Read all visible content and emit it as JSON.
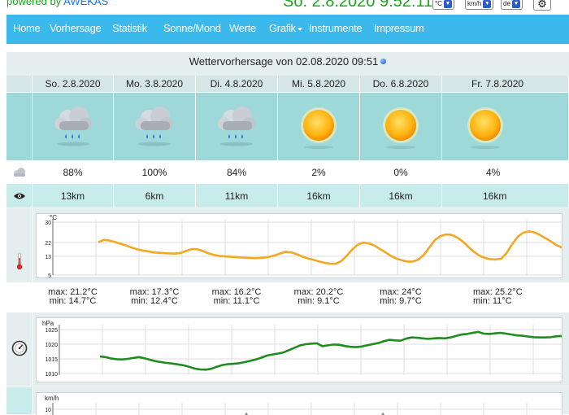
{
  "header": {
    "powered_prefix": "powered by",
    "powered_link": "AWEKAS",
    "datetime": "So. 2.8.2020 9:52:11",
    "temp_unit": "°C",
    "speed_unit": "km/h",
    "language": "de"
  },
  "nav": [
    {
      "label": "Home"
    },
    {
      "label": "Vorhersage"
    },
    {
      "label": "Statistik"
    },
    {
      "label": "Sonne/Mond"
    },
    {
      "label": "Werte"
    },
    {
      "label": "Grafik"
    },
    {
      "label": "Instrumente"
    },
    {
      "label": "Impressum"
    }
  ],
  "forecast": {
    "title": "Wettervorhersage von 02.08.2020 09:51",
    "days": [
      {
        "date": "So. 2.8.2020",
        "icon": "rain-cloud-icon",
        "clouds": "88%",
        "visibility": "13km",
        "max": "max: 21.2°C",
        "min": "min: 14.7°C"
      },
      {
        "date": "Mo. 3.8.2020",
        "icon": "rain-cloud-icon",
        "clouds": "100%",
        "visibility": "6km",
        "max": "max: 17.3°C",
        "min": "min: 12.4°C"
      },
      {
        "date": "Di. 4.8.2020",
        "icon": "rain-cloud-icon",
        "clouds": "84%",
        "visibility": "11km",
        "max": "max: 16.2°C",
        "min": "min: 11.1°C"
      },
      {
        "date": "Mi. 5.8.2020",
        "icon": "sun-icon",
        "clouds": "2%",
        "visibility": "16km",
        "max": "max: 20.2°C",
        "min": "min: 9.1°C"
      },
      {
        "date": "Do. 6.8.2020",
        "icon": "sun-icon",
        "clouds": "0%",
        "visibility": "16km",
        "max": "max: 24°C",
        "min": "min: 9.7°C"
      },
      {
        "date": "Fr. 7.8.2020",
        "icon": "sun-icon",
        "clouds": "4%",
        "visibility": "16km",
        "max": "max: 25.2°C",
        "min": "min: 11°C"
      }
    ]
  },
  "colors": {
    "nav": "#3bb9ec",
    "temp_line": "#f5a623",
    "pressure_line": "#1e8c1e",
    "powered": "#1aa61a"
  },
  "chart_data": [
    {
      "type": "line",
      "ylabel": "°C",
      "ylim": [
        5,
        30
      ],
      "yticks": [
        5,
        13,
        22,
        30
      ],
      "series": [
        {
          "values": [
            20.5,
            21.6,
            21.3,
            20.6,
            19.8,
            19.0,
            18.0,
            17.2,
            16.6,
            16.2,
            15.7,
            15.5,
            15.3,
            15.2,
            15.1,
            15.5,
            16.5,
            17.3,
            17.2,
            16.3,
            15.2,
            14.5,
            14.0,
            13.8,
            13.6,
            13.5,
            13.3,
            13.1,
            13.0,
            13.0,
            13.2,
            13.6,
            14.3,
            15.2,
            16.0,
            15.7,
            14.8,
            13.7,
            12.8,
            12.2,
            11.4,
            10.8,
            10.4,
            10.3,
            11.5,
            14.0,
            17.0,
            19.3,
            20.3,
            20.0,
            19.0,
            17.4,
            15.8,
            14.1,
            12.8,
            12.0,
            11.4,
            11.4,
            12.3,
            14.5,
            18.0,
            21.5,
            23.4,
            24.2,
            24.0,
            22.8,
            21.0,
            18.5,
            16.2,
            14.3,
            13.2,
            12.5,
            12.3,
            12.7,
            15.3,
            19.5,
            23.0,
            25.0,
            25.6,
            25.2,
            24.0,
            22.5,
            21.0,
            19.2,
            18.0
          ]
        }
      ],
      "grid": true
    },
    {
      "type": "line",
      "ylabel": "hPa",
      "ylim": [
        1010,
        1025
      ],
      "yticks": [
        1010,
        1015,
        1020,
        1025
      ],
      "series": [
        {
          "values": [
            1015.8,
            1015.6,
            1015.1,
            1014.9,
            1014.8,
            1015.0,
            1015.3,
            1015.6,
            1015.2,
            1014.7,
            1014.2,
            1013.9,
            1013.6,
            1013.4,
            1013.1,
            1012.8,
            1012.3,
            1011.7,
            1011.4,
            1011.3,
            1011.6,
            1012.3,
            1012.9,
            1013.2,
            1013.3,
            1013.5,
            1013.9,
            1014.3,
            1014.8,
            1015.4,
            1016.1,
            1016.5,
            1016.8,
            1017.2,
            1018.0,
            1018.8,
            1019.6,
            1020.0,
            1020.2,
            1020.3,
            1019.3,
            1019.6,
            1019.9,
            1019.8,
            1019.4,
            1019.1,
            1019.0,
            1019.2,
            1019.6,
            1020.0,
            1020.4,
            1021.0,
            1021.5,
            1021.3,
            1021.2,
            1021.9,
            1022.3,
            1022.2,
            1022.0,
            1021.8,
            1022.0,
            1022.1,
            1022.0,
            1022.3,
            1022.8,
            1023.3,
            1023.5,
            1023.9,
            1024.2,
            1023.6,
            1023.5,
            1023.7,
            1023.9,
            1023.6,
            1023.3,
            1023.0,
            1022.9,
            1022.6,
            1022.4,
            1022.3,
            1022.3,
            1022.4,
            1022.7,
            1022.8
          ]
        }
      ],
      "grid": true
    },
    {
      "type": "line",
      "ylabel": "km/h",
      "ylim": [
        0,
        10
      ],
      "yticks": [
        10
      ],
      "series": [],
      "grid": true
    }
  ]
}
